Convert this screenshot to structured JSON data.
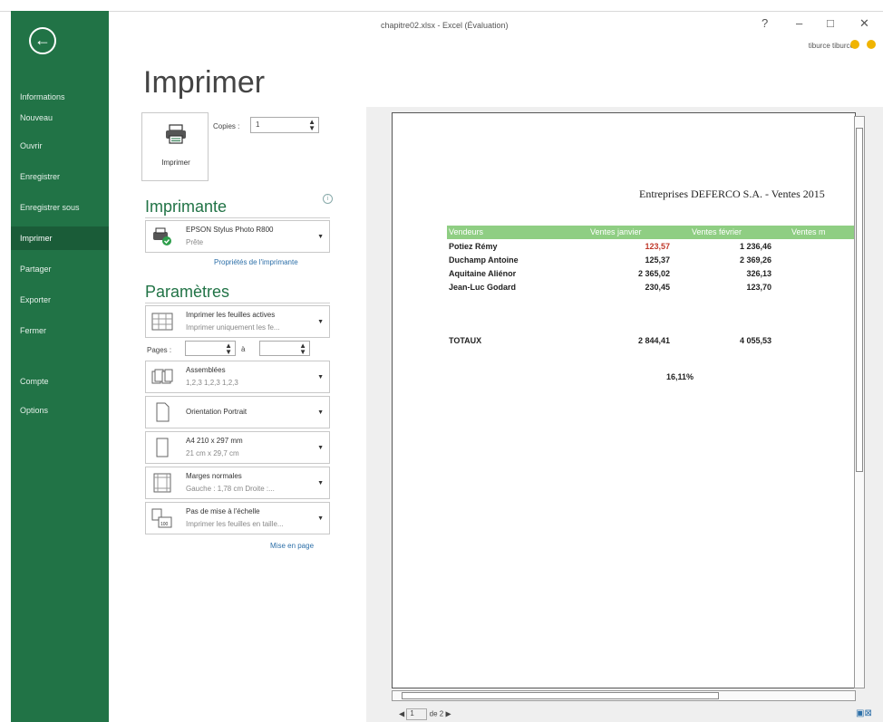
{
  "window": {
    "title": "chapitre02.xlsx - Excel (Évaluation)",
    "buttons": [
      "?",
      "–",
      "□",
      "✕"
    ],
    "user": "tiburce tiburce"
  },
  "sidebar": {
    "back": "←",
    "items": [
      {
        "label": "Informations"
      },
      {
        "label": "Nouveau"
      },
      {
        "label": "Ouvrir"
      },
      {
        "label": "Enregistrer"
      },
      {
        "label": "Enregistrer sous"
      },
      {
        "label": "Imprimer",
        "active": true
      },
      {
        "label": "Partager"
      },
      {
        "label": "Exporter"
      },
      {
        "label": "Fermer"
      },
      {
        "label": "Compte"
      },
      {
        "label": "Options"
      }
    ]
  },
  "main": {
    "heading": "Imprimer",
    "print_button": "Imprimer",
    "copies_label": "Copies :",
    "copies_value": "1",
    "printer_section": "Imprimante",
    "printer_name": "EPSON Stylus Photo R800",
    "printer_status": "Prête",
    "printer_properties": "Propriétés de l'imprimante",
    "settings_section": "Paramètres",
    "settings": [
      {
        "line1": "Imprimer les feuilles actives",
        "line2": "Imprimer uniquement les fe..."
      },
      {
        "line1": "Assemblées",
        "line2": "1,2,3   1,2,3   1,2,3"
      },
      {
        "line1": "Orientation Portrait",
        "line2": ""
      },
      {
        "line1": "A4 210 x 297 mm",
        "line2": "21 cm x 29,7 cm"
      },
      {
        "line1": "Marges normales",
        "line2": "Gauche : 1,78 cm   Droite :..."
      },
      {
        "line1": "Pas de mise à l'échelle",
        "line2": "Imprimer les feuilles en taille..."
      }
    ],
    "pages_label": "Pages :",
    "pages_to": "à",
    "page_setup": "Mise en page"
  },
  "preview": {
    "sheet_title": "Entreprises DEFERCO S.A. - Ventes 2015",
    "headers": [
      "Vendeurs",
      "Ventes janvier",
      "Ventes février",
      "Ventes m"
    ],
    "rows": [
      {
        "name": "Potiez Rémy",
        "jan": "123,57",
        "feb": "1 236,46"
      },
      {
        "name": "Duchamp Antoine",
        "jan": "125,37",
        "feb": "2 369,26"
      },
      {
        "name": "Aquitaine Aliénor",
        "jan": "2 365,02",
        "feb": "326,13"
      },
      {
        "name": "Jean-Luc Godard",
        "jan": "230,45",
        "feb": "123,70"
      }
    ],
    "totals_label": "TOTAUX",
    "totals_jan": "2 844,41",
    "totals_feb": "4 055,53",
    "percent": "16,11%",
    "red_value_color": "#c0392b",
    "page_current": "1",
    "page_of": "de 2"
  },
  "colors": {
    "accent": "#217346",
    "header_green": "#8fce83"
  }
}
